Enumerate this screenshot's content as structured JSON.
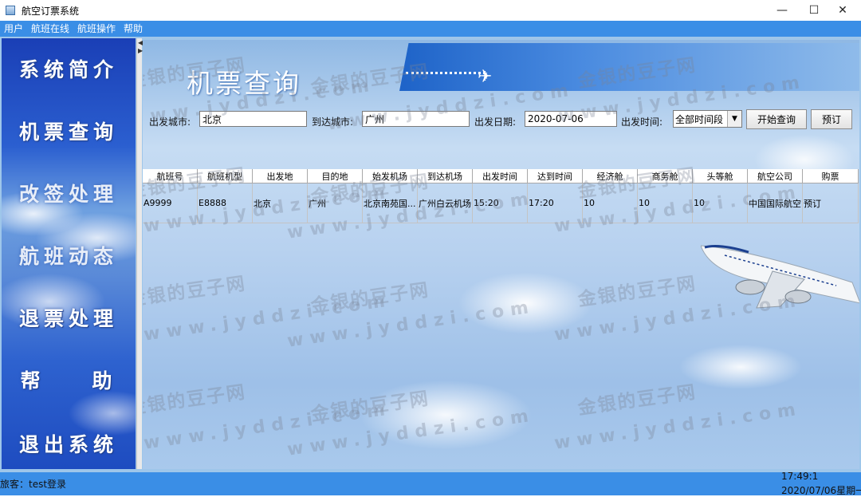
{
  "window": {
    "title": "航空订票系统",
    "min_glyph": "—",
    "max_glyph": "☐",
    "close_glyph": "✕"
  },
  "menu": [
    "用户",
    "航班在线",
    "航班操作",
    "帮助"
  ],
  "sidebar": {
    "items": [
      "系统简介",
      "机票查询",
      "改签处理",
      "航班动态",
      "退票处理",
      "帮    助",
      "退出系统"
    ]
  },
  "content": {
    "title": "机票查询",
    "form": {
      "from_label": "出发城市:",
      "from_value": "北京",
      "to_label": "到达城市:",
      "to_value": "广州",
      "date_label": "出发日期:",
      "date_value": "2020-07-06",
      "time_label": "出发时间:",
      "time_value": "全部时间段",
      "search_button": "开始查询",
      "book_button": "预订"
    },
    "table": {
      "columns": [
        "航班号",
        "航班机型",
        "出发地",
        "目的地",
        "始发机场",
        "到达机场",
        "出发时间",
        "达到时间",
        "经济舱",
        "商务舱",
        "头等舱",
        "航空公司",
        "购票"
      ],
      "rows": [
        [
          "A9999",
          "E8888",
          "北京",
          "广州",
          "北京南苑国...",
          "广州白云机场",
          "15:20",
          "17:20",
          "10",
          "10",
          "10",
          "中国国际航空",
          "预订"
        ]
      ]
    }
  },
  "watermark": {
    "line1": "金银的豆子网",
    "line2": "www.jyddzi.com"
  },
  "status": {
    "user": "旅客：test登录",
    "time": "17:49:1",
    "date": "2020/07/06星期一"
  },
  "colors": {
    "menu_bar": "#3a8ee6",
    "status_bar": "#3a8ee6",
    "sidebar_top": "#1a3fb6"
  }
}
